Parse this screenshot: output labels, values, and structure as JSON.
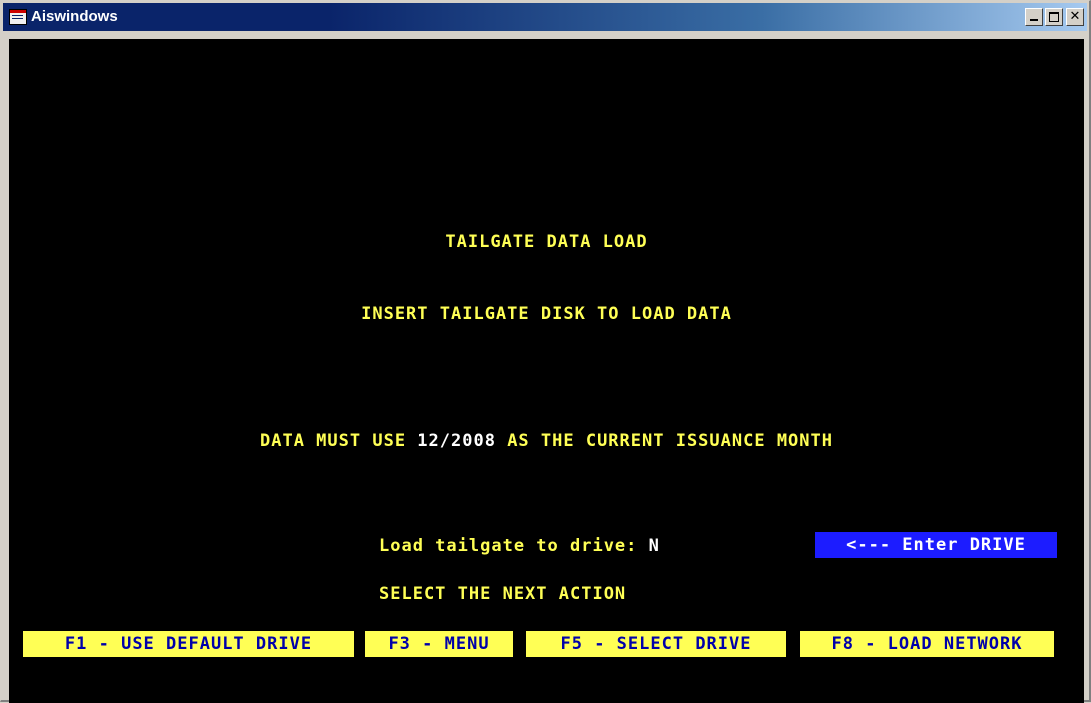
{
  "window": {
    "title": "Aiswindows"
  },
  "screen": {
    "heading": "TAILGATE DATA LOAD",
    "instruction": "INSERT TAILGATE DISK TO LOAD DATA",
    "month_prefix": "DATA MUST USE ",
    "month_value": "12/2008",
    "month_suffix": " AS THE CURRENT ISSUANCE MONTH",
    "load_label": "Load tailgate to drive: ",
    "load_value": "N",
    "drive_prompt": "<--- Enter DRIVE",
    "next_action": "SELECT THE NEXT ACTION"
  },
  "function_keys": [
    {
      "label": "F1 - USE DEFAULT DRIVE"
    },
    {
      "label": "F3 - MENU"
    },
    {
      "label": "F5 - SELECT DRIVE"
    },
    {
      "label": "F8 - LOAD NETWORK"
    }
  ],
  "colors": {
    "console_bg": "#000000",
    "text": "#ffff55",
    "highlight_bg": "#1c1cff",
    "fkey_bg": "#ffff55",
    "fkey_text": "#0000aa"
  },
  "icons": [
    "app-window-icon",
    "minimize-icon",
    "maximize-icon",
    "close-icon"
  ]
}
